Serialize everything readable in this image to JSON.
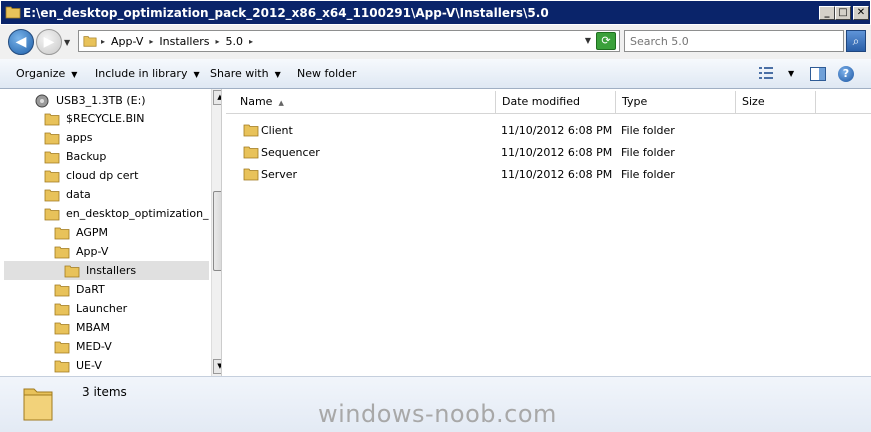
{
  "window": {
    "title": "E:\\en_desktop_optimization_pack_2012_x86_x64_1100291\\App-V\\Installers\\5.0",
    "minimize": "_",
    "maximize": "□",
    "close": "✕"
  },
  "address": {
    "crumbs": [
      "App-V",
      "Installers",
      "5.0"
    ],
    "search_placeholder": "Search 5.0"
  },
  "toolbar": {
    "organize": "Organize",
    "include_in_library": "Include in library",
    "share_with": "Share with",
    "new_folder": "New folder"
  },
  "tree": {
    "items": [
      {
        "label": "USB3_1.3TB (E:)",
        "icon": "drive-icon"
      },
      {
        "label": "$RECYCLE.BIN",
        "icon": "folder-icon"
      },
      {
        "label": "apps",
        "icon": "folder-icon"
      },
      {
        "label": "Backup",
        "icon": "folder-icon"
      },
      {
        "label": "cloud dp cert",
        "icon": "folder-icon"
      },
      {
        "label": "data",
        "icon": "folder-icon"
      },
      {
        "label": "en_desktop_optimization_pac",
        "icon": "folder-icon"
      },
      {
        "label": "AGPM",
        "icon": "folder-icon"
      },
      {
        "label": "App-V",
        "icon": "folder-icon"
      },
      {
        "label": "Installers",
        "icon": "folder-icon"
      },
      {
        "label": "DaRT",
        "icon": "folder-icon"
      },
      {
        "label": "Launcher",
        "icon": "folder-icon"
      },
      {
        "label": "MBAM",
        "icon": "folder-icon"
      },
      {
        "label": "MED-V",
        "icon": "folder-icon"
      },
      {
        "label": "UE-V",
        "icon": "folder-icon"
      }
    ]
  },
  "columns": {
    "name": "Name",
    "date_modified": "Date modified",
    "type": "Type",
    "size": "Size"
  },
  "files": [
    {
      "name": "Client",
      "date": "11/10/2012 6:08 PM",
      "type": "File folder"
    },
    {
      "name": "Sequencer",
      "date": "11/10/2012 6:08 PM",
      "type": "File folder"
    },
    {
      "name": "Server",
      "date": "11/10/2012 6:08 PM",
      "type": "File folder"
    }
  ],
  "details": {
    "count": "3 items"
  },
  "watermark": "windows-noob.com",
  "colors": {
    "title_bar": "#0a246a",
    "folder": "#e8c25a",
    "selection": "#e0e0e0"
  }
}
